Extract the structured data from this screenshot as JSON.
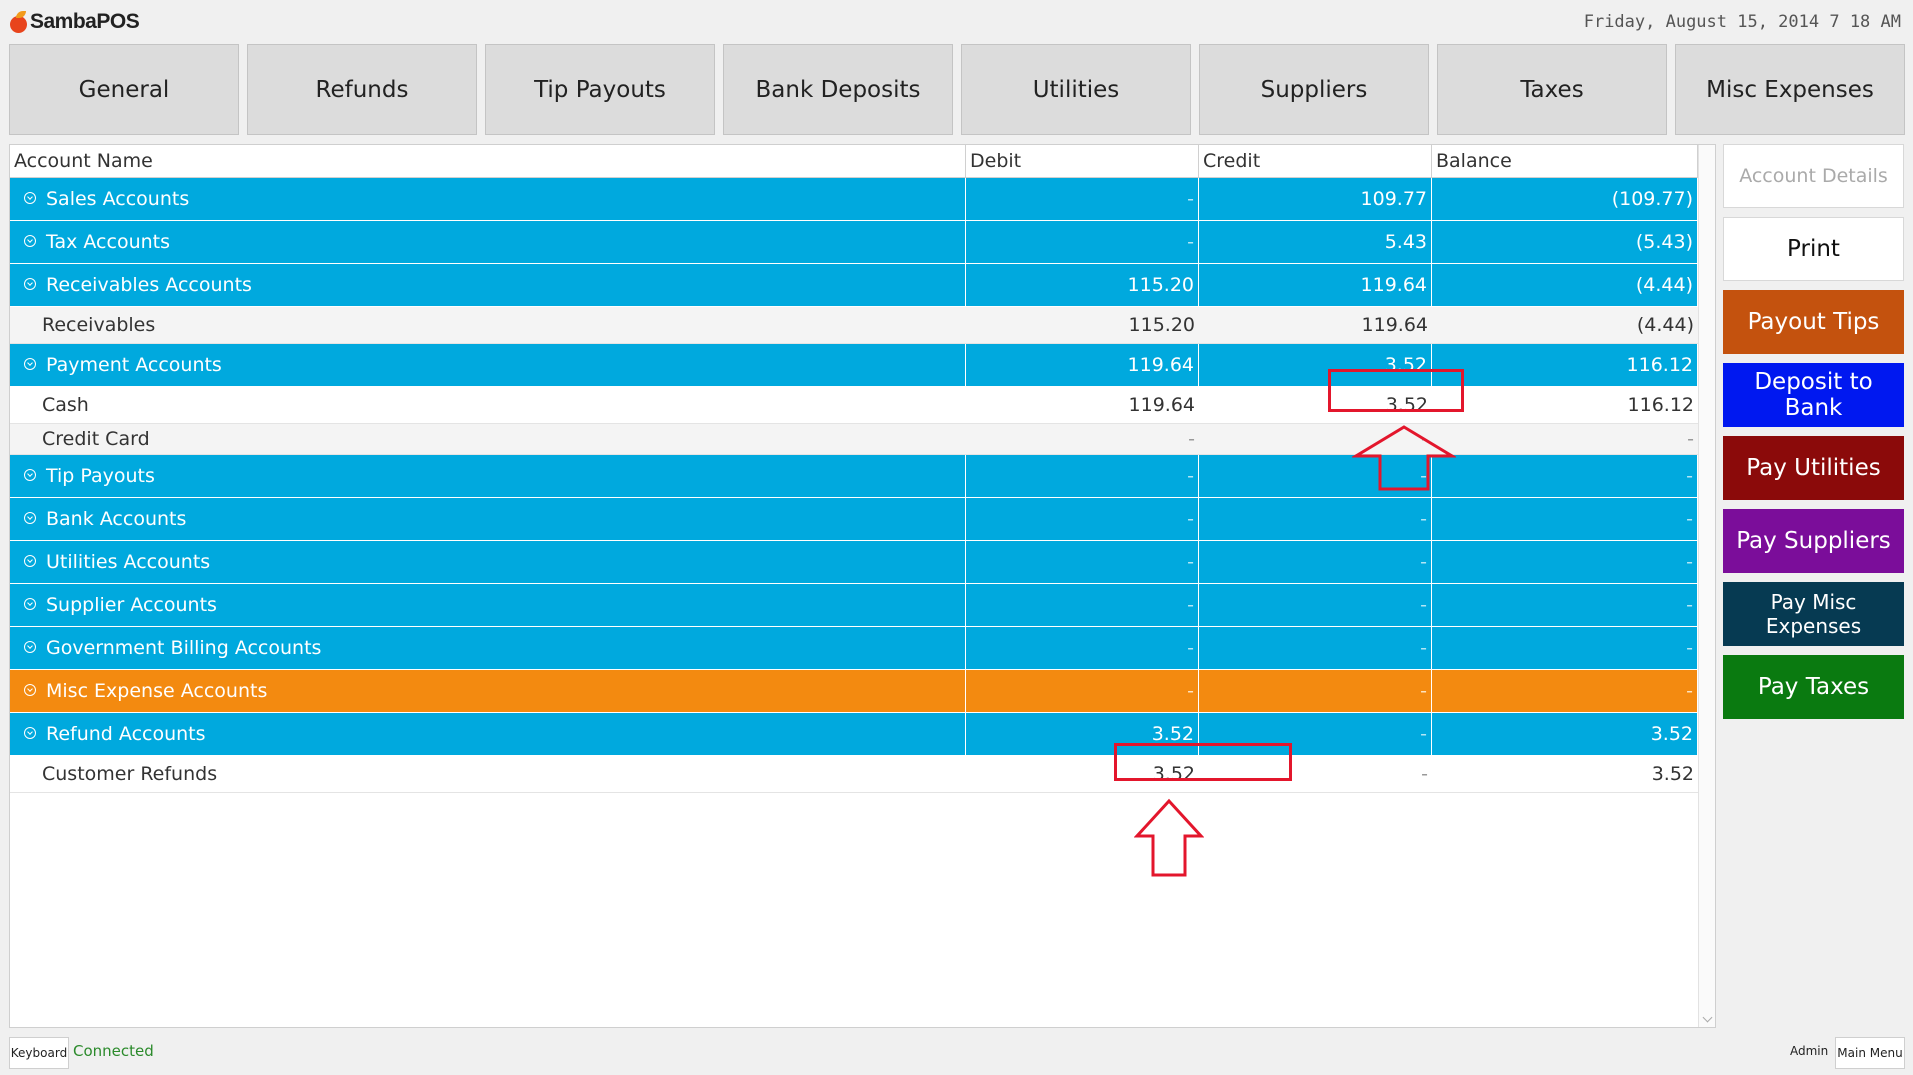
{
  "app": {
    "name": "SambaPOS",
    "datetime": "Friday, August 15, 2014 7 18 AM"
  },
  "tabs": [
    {
      "label": "General"
    },
    {
      "label": "Refunds"
    },
    {
      "label": "Tip Payouts"
    },
    {
      "label": "Bank Deposits"
    },
    {
      "label": "Utilities"
    },
    {
      "label": "Suppliers"
    },
    {
      "label": "Taxes"
    },
    {
      "label": "Misc Expenses"
    }
  ],
  "grid": {
    "columns": {
      "name": "Account Name",
      "debit": "Debit",
      "credit": "Credit",
      "balance": "Balance"
    },
    "rows": [
      {
        "kind": "group",
        "color": "blue",
        "name": "Sales Accounts",
        "debit": "-",
        "credit": "109.77",
        "balance": "(109.77)"
      },
      {
        "kind": "group",
        "color": "blue",
        "name": "Tax Accounts",
        "debit": "-",
        "credit": "5.43",
        "balance": "(5.43)"
      },
      {
        "kind": "group",
        "color": "blue",
        "name": "Receivables Accounts",
        "debit": "115.20",
        "credit": "119.64",
        "balance": "(4.44)"
      },
      {
        "kind": "detail",
        "alt": true,
        "tall": true,
        "name": "Receivables",
        "debit": "115.20",
        "credit": "119.64",
        "balance": "(4.44)"
      },
      {
        "kind": "group",
        "color": "blue",
        "name": "Payment Accounts",
        "debit": "119.64",
        "credit": "3.52",
        "balance": "116.12"
      },
      {
        "kind": "detail",
        "alt": false,
        "tall": true,
        "name": "Cash",
        "debit": "119.64",
        "credit": "3.52",
        "balance": "116.12"
      },
      {
        "kind": "detail",
        "alt": true,
        "tall": false,
        "name": "Credit Card",
        "debit": "-",
        "credit": "-",
        "balance": "-"
      },
      {
        "kind": "group",
        "color": "blue",
        "name": "Tip Payouts",
        "debit": "-",
        "credit": "-",
        "balance": "-"
      },
      {
        "kind": "group",
        "color": "blue",
        "name": "Bank Accounts",
        "debit": "-",
        "credit": "-",
        "balance": "-"
      },
      {
        "kind": "group",
        "color": "blue",
        "name": "Utilities Accounts",
        "debit": "-",
        "credit": "-",
        "balance": "-"
      },
      {
        "kind": "group",
        "color": "blue",
        "name": "Supplier Accounts",
        "debit": "-",
        "credit": "-",
        "balance": "-"
      },
      {
        "kind": "group",
        "color": "blue",
        "name": "Government Billing Accounts",
        "debit": "-",
        "credit": "-",
        "balance": "-"
      },
      {
        "kind": "group",
        "color": "orange",
        "name": "Misc Expense Accounts",
        "debit": "-",
        "credit": "-",
        "balance": "-"
      },
      {
        "kind": "group",
        "color": "blue",
        "name": "Refund Accounts",
        "debit": "3.52",
        "credit": "-",
        "balance": "3.52"
      },
      {
        "kind": "detail",
        "alt": false,
        "tall": true,
        "name": "Customer Refunds",
        "debit": "3.52",
        "credit": "-",
        "balance": "3.52"
      }
    ]
  },
  "side_buttons": {
    "account_details": "Account Details",
    "print": "Print",
    "payout_tips": "Payout Tips",
    "deposit_to_bank": "Deposit to Bank",
    "pay_utilities": "Pay Utilities",
    "pay_suppliers": "Pay Suppliers",
    "pay_misc_expenses": "Pay Misc Expenses",
    "pay_taxes": "Pay Taxes"
  },
  "colors": {
    "group_blue": "#00a9de",
    "group_orange": "#f38a10",
    "payout_tips": "#c4520e",
    "deposit_to_bank": "#0018f0",
    "pay_utilities": "#8b0a0a",
    "pay_suppliers": "#7b0d9a",
    "pay_misc_expenses": "#063a52",
    "pay_taxes": "#0a7a10",
    "annotation": "#e3162c"
  },
  "footer": {
    "keyboard": "Keyboard",
    "status": "Connected",
    "user": "Admin",
    "main_menu": "Main Menu"
  }
}
